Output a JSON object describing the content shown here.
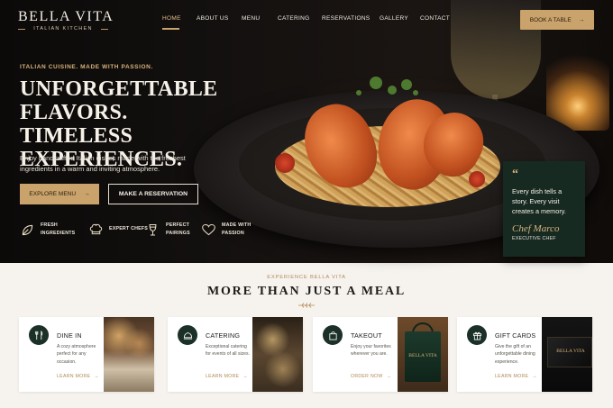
{
  "brand": {
    "name": "BELLA VITA",
    "tagline": "ITALIAN KITCHEN"
  },
  "nav": {
    "items": [
      {
        "label": "HOME",
        "active": true
      },
      {
        "label": "ABOUT US"
      },
      {
        "label": "MENU"
      },
      {
        "label": "CATERING"
      },
      {
        "label": "RESERVATIONS"
      },
      {
        "label": "GALLERY"
      },
      {
        "label": "CONTACT"
      }
    ],
    "cta": "BOOK A TABLE"
  },
  "hero": {
    "eyebrow": "ITALIAN CUISINE. MADE WITH PASSION.",
    "headline": "UNFORGETTABLE FLAVORS. TIMELESS EXPERIENCES.",
    "description": "Enjoy handcrafted Italian dishes made with the freshest ingredients in a warm and inviting atmosphere.",
    "primary_button": "EXPLORE MENU",
    "secondary_button": "MAKE A RESERVATION",
    "features": [
      {
        "icon": "leaf-icon",
        "label": "FRESH INGREDIENTS"
      },
      {
        "icon": "chef-hat-icon",
        "label": "EXPERT CHEFS"
      },
      {
        "icon": "wine-glass-icon",
        "label": "PERFECT PAIRINGS"
      },
      {
        "icon": "heart-icon",
        "label": "MADE WITH PASSION"
      }
    ],
    "quote": {
      "mark": "“",
      "text": "Every dish tells a story. Every visit creates a memory.",
      "signature": "Chef Marco",
      "role": "EXECUTIVE CHEF"
    }
  },
  "experience": {
    "eyebrow": "EXPERIENCE BELLA VITA",
    "title": "MORE THAN JUST A MEAL",
    "cards": [
      {
        "icon": "fork-knife-icon",
        "title": "DINE IN",
        "description": "A cozy atmosphere perfect for any occasion.",
        "link": "LEARN MORE"
      },
      {
        "icon": "cloche-icon",
        "title": "CATERING",
        "description": "Exceptional catering for events of all sizes.",
        "link": "LEARN MORE"
      },
      {
        "icon": "shopping-bag-icon",
        "title": "TAKEOUT",
        "description": "Enjoy your favorites wherever you are.",
        "link": "ORDER NOW"
      },
      {
        "icon": "gift-icon",
        "title": "GIFT CARDS",
        "description": "Give the gift of an unforgettable dining experience.",
        "link": "LEARN MORE"
      }
    ]
  },
  "colors": {
    "accent": "#c9a36b",
    "dark_green": "#1b3027",
    "hero_bg": "#0f0c0a",
    "page_bg": "#f6f3ee"
  }
}
